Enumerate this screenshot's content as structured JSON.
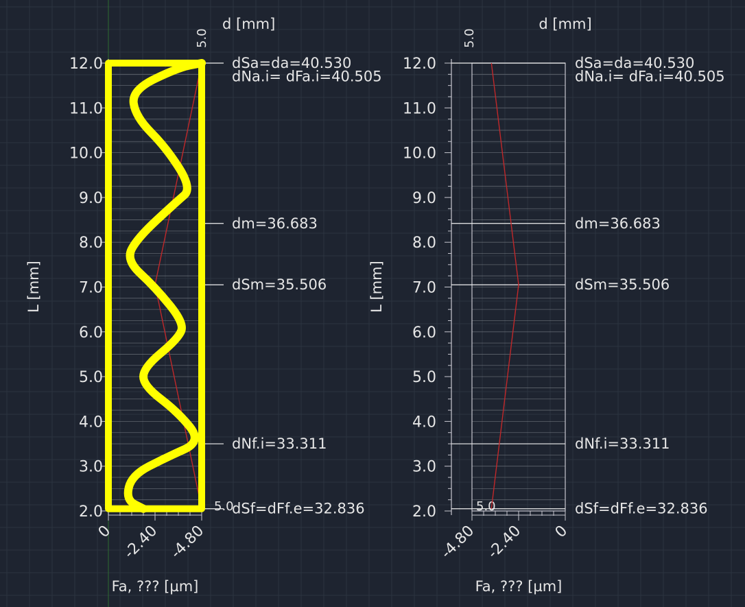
{
  "colors": {
    "background": "#1e2430",
    "grid": "#2c3440",
    "grid_accent": "#3a4656",
    "text": "#e6e6e6",
    "frame": "#c8c8d0",
    "hatch": "#7a8088",
    "profile": "#c0282a",
    "highlight": "#ffff00",
    "origin_axis": "#2f6b2f"
  },
  "chart_data": [
    {
      "type": "line",
      "panel": "left",
      "title": "d [mm]",
      "ylabel": "L [mm]",
      "xlabel": "Fa, ??? [µm]",
      "ylim": [
        2.0,
        12.0
      ],
      "y_ticks": [
        "2.0",
        "3.0",
        "4.0",
        "5.0",
        "6.0",
        "7.0",
        "8.0",
        "9.0",
        "10.0",
        "11.0",
        "12.0"
      ],
      "x_ticks": [
        "0",
        "-2.40",
        "-4.80"
      ],
      "x_direction": "increasing-deviation-to-the-right",
      "top_marker": "5.0",
      "bottom_marker": "5.0",
      "diameter_lines": [
        {
          "label": "dSa=da=40.530",
          "L": 12.0
        },
        {
          "label": "dNa.i=  dFa.i=40.505",
          "L": 11.7
        },
        {
          "label": "dm=36.683",
          "L": 8.42
        },
        {
          "label": "dSm=35.506",
          "L": 7.05
        },
        {
          "label": "dNf.i=33.311",
          "L": 3.5
        },
        {
          "label": "dSf=dFf.e=32.836",
          "L": 2.05
        }
      ],
      "series": [
        {
          "color": "#c0282a",
          "points": [
            [
              -4.8,
              2.05
            ],
            [
              -2.4,
              7.05
            ],
            [
              -4.8,
              12.0
            ]
          ]
        }
      ],
      "annotations": {
        "highlight_frame": {
          "x_range": [
            0,
            -4.8
          ],
          "y_range": [
            2.05,
            12.0
          ]
        },
        "highlight_wave": [
          [
            -1.8,
            2.05
          ],
          [
            -0.9,
            2.25
          ],
          [
            -1.2,
            2.8
          ],
          [
            -3.0,
            3.2
          ],
          [
            -4.8,
            3.55
          ],
          [
            -3.6,
            4.2
          ],
          [
            -1.8,
            4.8
          ],
          [
            -1.8,
            5.2
          ],
          [
            -3.6,
            5.85
          ],
          [
            -3.9,
            6.2
          ],
          [
            -2.4,
            7.0
          ],
          [
            -0.9,
            7.6
          ],
          [
            -1.5,
            8.1
          ],
          [
            -3.5,
            8.9
          ],
          [
            -4.3,
            9.2
          ],
          [
            -3.0,
            10.1
          ],
          [
            -1.4,
            10.8
          ],
          [
            -1.2,
            11.4
          ],
          [
            -3.6,
            11.9
          ],
          [
            -4.8,
            12.0
          ]
        ]
      }
    },
    {
      "type": "line",
      "panel": "right",
      "title": "d [mm]",
      "ylabel": "L [mm]",
      "xlabel": "Fa, ??? [µm]",
      "ylim": [
        2.0,
        12.0
      ],
      "y_ticks": [
        "2.0",
        "3.0",
        "4.0",
        "5.0",
        "6.0",
        "7.0",
        "8.0",
        "9.0",
        "10.0",
        "11.0",
        "12.0"
      ],
      "x_ticks": [
        "-4.80",
        "-2.40",
        "0"
      ],
      "x_direction": "increasing-deviation-to-the-left",
      "top_marker": "5.0",
      "bottom_marker": "5.0",
      "diameter_lines": [
        {
          "label": "dSa=da=40.530",
          "L": 12.0
        },
        {
          "label": "dNa.i=  dFa.i=40.505",
          "L": 11.7
        },
        {
          "label": "dm=36.683",
          "L": 8.42
        },
        {
          "label": "dSm=35.506",
          "L": 7.05
        },
        {
          "label": "dNf.i=33.311",
          "L": 3.5
        },
        {
          "label": "dSf=dFf.e=32.836",
          "L": 2.05
        }
      ],
      "series": [
        {
          "color": "#c0282a",
          "points": [
            [
              -3.8,
              2.05
            ],
            [
              -2.4,
              7.05
            ],
            [
              -3.8,
              12.0
            ]
          ]
        }
      ]
    }
  ]
}
